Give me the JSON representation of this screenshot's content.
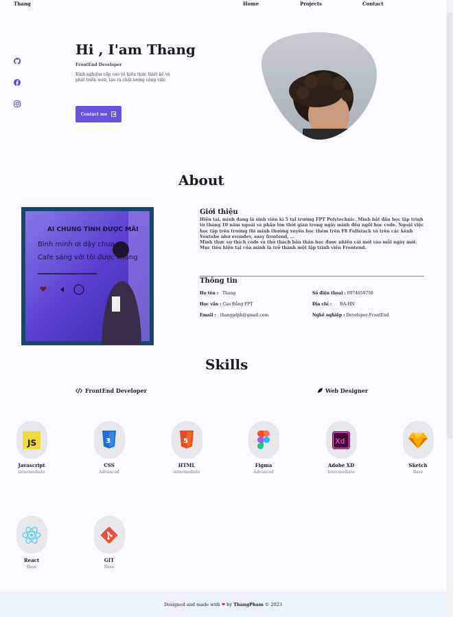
{
  "nav": {
    "logo": "Thang",
    "links": [
      "Home",
      "Projects",
      "Contact"
    ]
  },
  "social": [
    "github-icon",
    "facebook-icon",
    "instagram-icon"
  ],
  "hero": {
    "title": "Hi , I'am Thang",
    "subtitle": "FrontEnd Developer",
    "description": "Kinh nghiệm cấp cao về kiến thức thiết kế và phát triển web, tạo ra chất lượng công việc",
    "button_label": "Contact me"
  },
  "about": {
    "heading": "About",
    "intro_title": "Giới thiệu",
    "intro_text": "Hiện tại, mình đang là sinh viên kì 5 tại trường FPT Polytechnic. Mình bắt đầu học lập trình từ tháng 10 năm ngoái và phần lớn thời gian trong ngày mình đều ngồi học code. Ngoài việc học tập trên trường thì mình thường xuyên học thêm trên F8 Fullstack và trên các kênh Youtube như evondev, easy frontend, ...",
    "intro_text2": "Mình thực sự thích code và thử thách bản thân học được nhiều cái mới vào mỗi ngày mới. Mục tiêu hiện tại của mình là trở thành một lập trình viên Frontend.",
    "photo_text": [
      "AI CHUNG TÌNH ĐƯỢC MÃI",
      "Bình minh ơi dậy chưa",
      "Cafe sáng với tôi được không"
    ],
    "info_title": "Thông tin",
    "info": {
      "name_label": "Họ tên :",
      "name": "Thang",
      "phone_label": "Số điện thoại :",
      "phone": "0974659758",
      "edu_label": "Học vấn :",
      "edu": "Cao Đẳng FPT",
      "addr_label": "Địa chỉ :",
      "addr": "ĐA-HN",
      "email_label": "Email :",
      "email": "thangpdph@gmail.com",
      "job_label": "Nghề nghiệp :",
      "job": "Developer-FrontEnd"
    }
  },
  "skills": {
    "heading": "Skills",
    "cat_frontend": "FrontEnd Developer",
    "cat_design": "Web Designer",
    "items": [
      {
        "name": "Javascript",
        "level": "intermediate",
        "icon": "javascript-icon"
      },
      {
        "name": "CSS",
        "level": "Advanced",
        "icon": "css-icon"
      },
      {
        "name": "HTML",
        "level": "intermediate",
        "icon": "html-icon"
      },
      {
        "name": "Figma",
        "level": "Advanced",
        "icon": "figma-icon"
      },
      {
        "name": "Adobe XD",
        "level": "Intermediate",
        "icon": "adobe-xd-icon"
      },
      {
        "name": "Sketch",
        "level": "Base",
        "icon": "sketch-icon"
      },
      {
        "name": "React",
        "level": "Base",
        "icon": "react-icon"
      },
      {
        "name": "GIT",
        "level": "Base",
        "icon": "git-icon"
      }
    ]
  },
  "footer": {
    "pre": "Designed and made with",
    "by": "by",
    "author": "ThangPham",
    "year": "© 2023"
  },
  "colors": {
    "accent": "#6a51e0",
    "background": "#fbfaff",
    "footer_bg": "#edf3ff",
    "heart": "#e02424"
  }
}
